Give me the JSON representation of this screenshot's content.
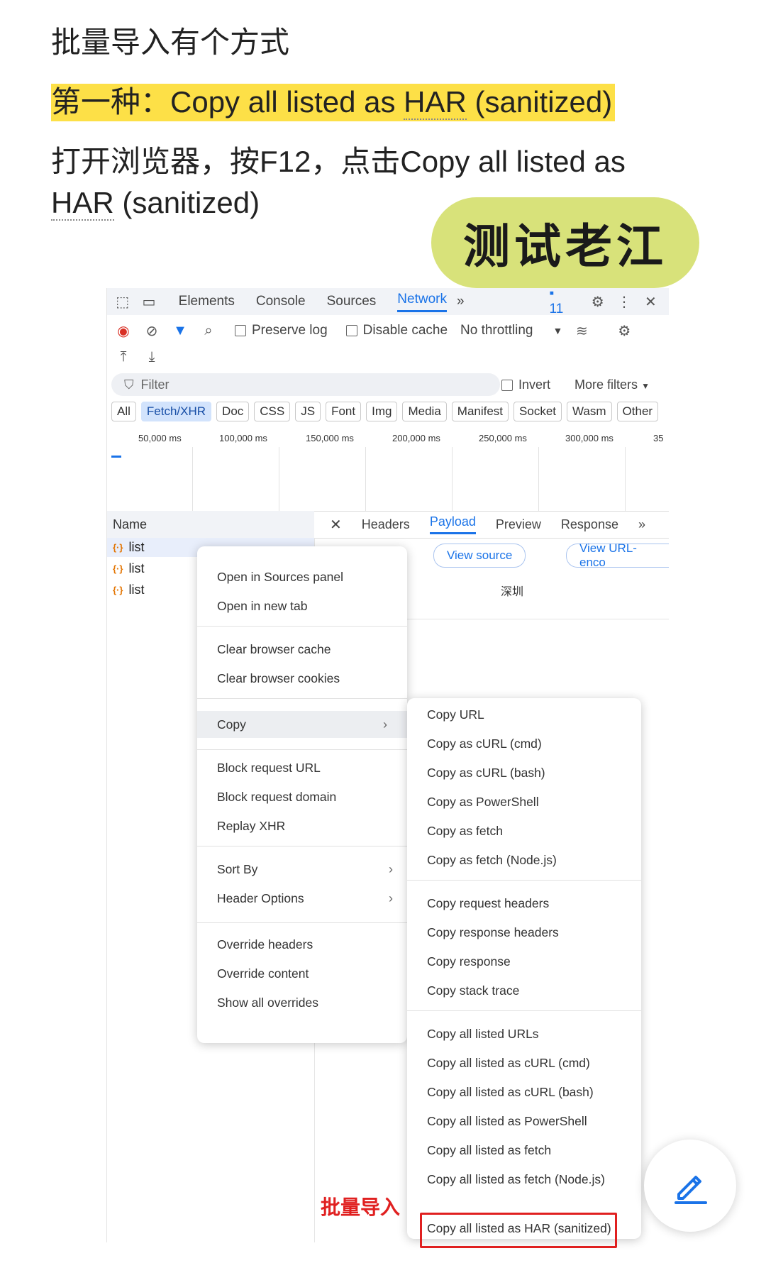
{
  "article": {
    "line1": "批量导入有个方式",
    "line2_prefix": "第一种：Copy all listed as ",
    "line2_har": "HAR",
    "line2_suffix": " (sanitized)",
    "line3": "打开浏览器，按F12，点击Copy all listed as",
    "line4_har": "HAR",
    "line4_suffix": " (sanitized)",
    "stamp": "测试老江"
  },
  "devtools": {
    "tabs": [
      "Elements",
      "Console",
      "Sources",
      "Network"
    ],
    "more_tabs": "»",
    "issues_count": "11",
    "toolbar": {
      "preserve_log": "Preserve log",
      "disable_cache": "Disable cache",
      "throttling": "No throttling"
    },
    "filter_placeholder": "Filter",
    "invert": "Invert",
    "more_filters": "More filters",
    "types": [
      "All",
      "Fetch/XHR",
      "Doc",
      "CSS",
      "JS",
      "Font",
      "Img",
      "Media",
      "Manifest",
      "Socket",
      "Wasm",
      "Other"
    ],
    "timeline_ticks": [
      "50,000 ms",
      "100,000 ms",
      "150,000 ms",
      "200,000 ms",
      "250,000 ms",
      "300,000 ms",
      "35"
    ],
    "name_header": "Name",
    "requests": [
      "list",
      "list",
      "list"
    ],
    "detail_tabs": [
      "Headers",
      "Payload",
      "Preview",
      "Response"
    ],
    "detail_more": "»",
    "view_source": "View source",
    "view_url_encoded": "View URL-enco",
    "payload_value": "深圳"
  },
  "context_menu": {
    "groups": [
      [
        "Open in Sources panel",
        "Open in new tab"
      ],
      [
        "Clear browser cache",
        "Clear browser cookies"
      ],
      [
        "Copy"
      ],
      [
        "Block request URL",
        "Block request domain",
        "Replay XHR"
      ],
      [
        "Sort By",
        "Header Options"
      ],
      [
        "Override headers",
        "Override content",
        "Show all overrides"
      ]
    ]
  },
  "copy_submenu": {
    "groups": [
      [
        "Copy URL",
        "Copy as cURL (cmd)",
        "Copy as cURL (bash)",
        "Copy as PowerShell",
        "Copy as fetch",
        "Copy as fetch (Node.js)"
      ],
      [
        "Copy request headers",
        "Copy response headers",
        "Copy response",
        "Copy stack trace"
      ],
      [
        "Copy all listed URLs",
        "Copy all listed as cURL (cmd)",
        "Copy all listed as cURL (bash)",
        "Copy all listed as PowerShell",
        "Copy all listed as fetch",
        "Copy all listed as fetch (Node.js)",
        "Copy all listed as HAR (sanitized)"
      ]
    ]
  },
  "annotation": "批量导入",
  "colors": {
    "accent": "#1a73e8",
    "highlight": "#fde047",
    "stamp": "#d8e27a",
    "annotation": "#e02020"
  }
}
